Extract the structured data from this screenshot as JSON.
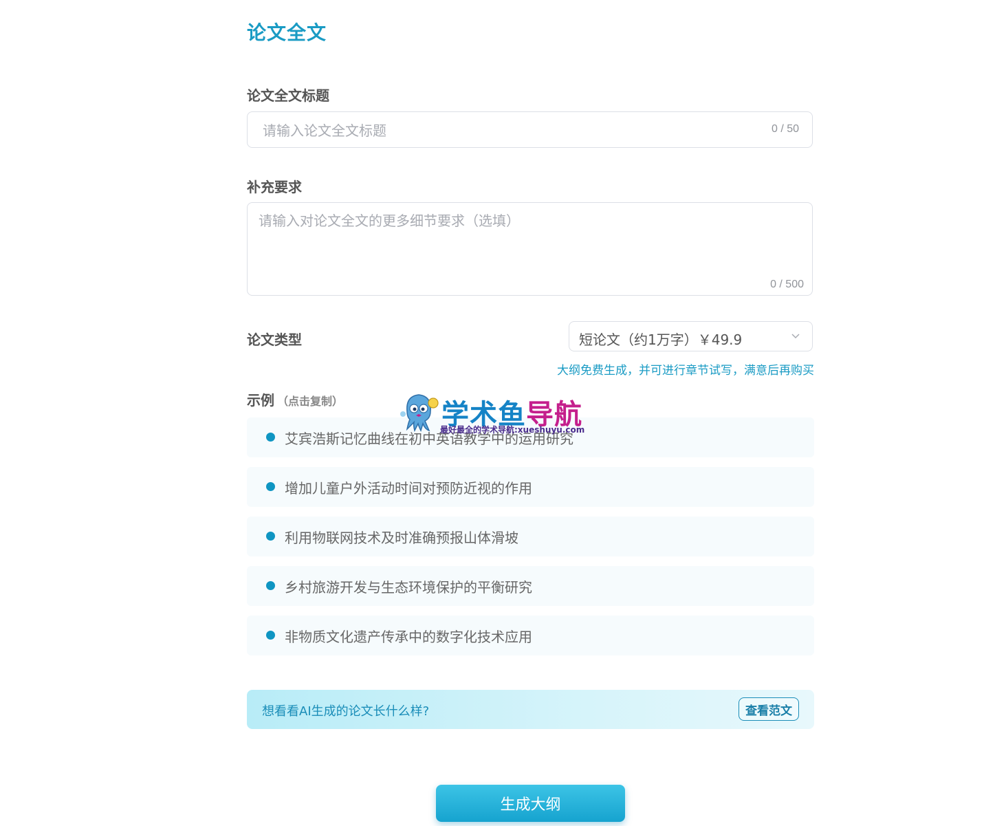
{
  "page": {
    "title": "论文全文"
  },
  "title_field": {
    "label": "论文全文标题",
    "value": "",
    "placeholder": "请输入论文全文标题",
    "counter": "0 / 50"
  },
  "extra_field": {
    "label": "补充要求",
    "value": "",
    "placeholder": "请输入对论文全文的更多细节要求（选填）",
    "counter": "0 / 500"
  },
  "paper_type": {
    "label": "论文类型",
    "selected": "短论文（约1万字）￥49.9",
    "note": "大纲免费生成，并可进行章节试写，满意后再购买"
  },
  "examples": {
    "label": "示例",
    "hint": "（点击复制）",
    "items": [
      "艾宾浩斯记忆曲线在初中英语教学中的运用研究",
      "增加儿童户外活动时间对预防近视的作用",
      "利用物联网技术及时准确预报山体滑坡",
      "乡村旅游开发与生态环境保护的平衡研究",
      "非物质文化遗产传承中的数字化技术应用"
    ]
  },
  "banner": {
    "text": "想看看AI生成的论文长什么样?",
    "button_label": "查看范文"
  },
  "generate_button": {
    "label": "生成大纲"
  },
  "watermark": {
    "name_part1": "学术鱼",
    "name_part2": "导航",
    "tagline": "最好最全的学术导航:xueshuyu.com"
  },
  "colors": {
    "accent": "#1a9bc4",
    "dot": "#0f95c2",
    "watermark_blue": "#1583c6",
    "watermark_magenta": "#c41f8c"
  },
  "icons": {
    "select_caret": "chevron-down-icon",
    "bullet": "bullet-dot-icon",
    "mascot": "octopus-mascot-icon"
  }
}
